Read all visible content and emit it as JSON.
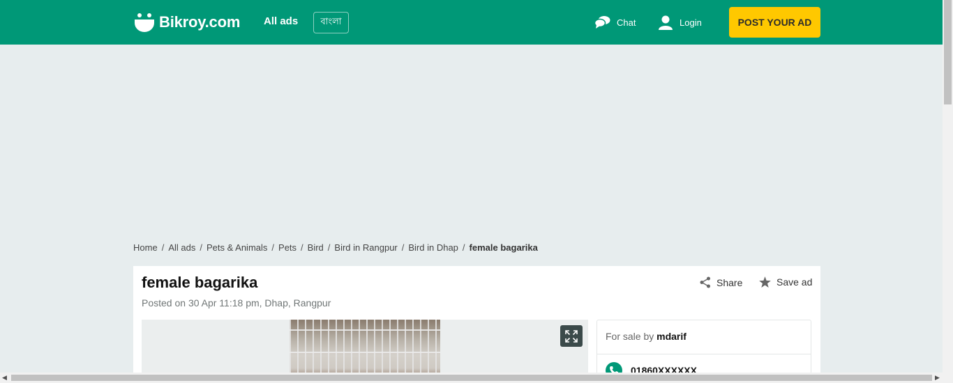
{
  "header": {
    "brand": "Bikroy.com",
    "nav_all_ads": "All ads",
    "language_button": "বাংলা",
    "chat": "Chat",
    "login": "Login",
    "post_ad": "POST YOUR AD",
    "brand_color": "#009877",
    "post_ad_color": "#ffc800"
  },
  "breadcrumb": {
    "items": [
      "Home",
      "All ads",
      "Pets & Animals",
      "Pets",
      "Bird",
      "Bird in Rangpur",
      "Bird in Dhap"
    ],
    "current": "female bagarika",
    "separator": "/"
  },
  "ad": {
    "title": "female bagarika",
    "meta": "Posted on 30 Apr 11:18 pm, Dhap, Rangpur",
    "share_label": "Share",
    "save_label": "Save ad"
  },
  "seller": {
    "prefix": "For sale by",
    "name": "mdarif",
    "phone": "01860XXXXXX"
  },
  "icons": {
    "chat": "chat-bubbles-icon",
    "login": "user-icon",
    "share": "share-icon",
    "save": "star-icon",
    "expand": "expand-icon",
    "phone": "phone-icon"
  }
}
